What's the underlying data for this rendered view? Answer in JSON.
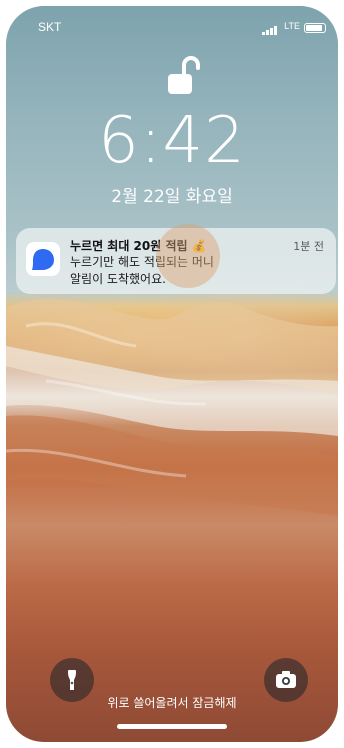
{
  "status_bar": {
    "carrier": "SKT",
    "network": "LTE",
    "icons": [
      "signal-bars-icon",
      "battery-icon"
    ]
  },
  "lock_screen": {
    "lock_state": "unlocked",
    "time": "6:42",
    "date": "2월 22일 화요일"
  },
  "notification": {
    "app_icon": "chat-bubble-icon",
    "title": "누르면 최대 20원 적립",
    "title_emoji": "💰",
    "time": "1분 전",
    "body_line1": "누르기만 해도 적립되는 머니",
    "body_line2": "알림이 도착했어요."
  },
  "quick_actions": {
    "left": "flashlight-icon",
    "right": "camera-icon"
  },
  "unlock_hint": "위로 쓸어올려서 잠금해제",
  "colors": {
    "app_icon_blue": "#2f6bf2",
    "sky": "#8fb0b8"
  }
}
